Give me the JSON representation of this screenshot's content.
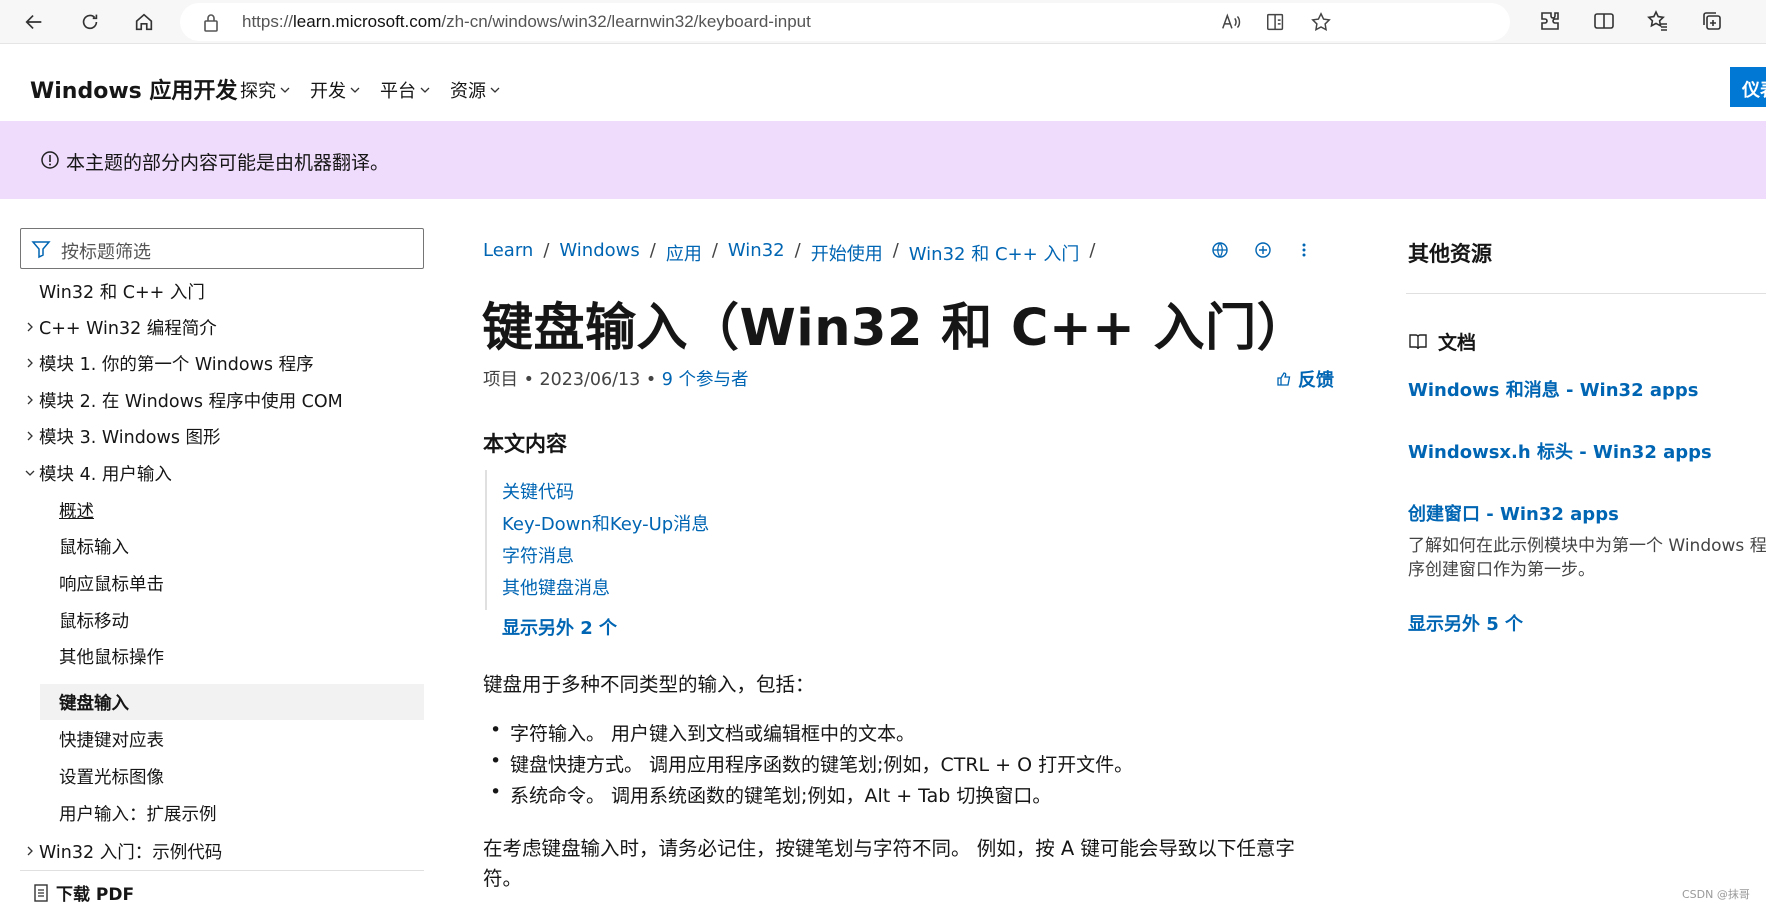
{
  "browser": {
    "url_prefix": "https://",
    "url_host": "learn.microsoft.com",
    "url_path": "/zh-cn/windows/win32/learnwin32/keyboard-input"
  },
  "header": {
    "site_title": "Windows 应用开发",
    "nav": [
      "探究",
      "开发",
      "平台",
      "资源"
    ],
    "cta": "仪表"
  },
  "banner": {
    "text": "本主题的部分内容可能是由机器翻译。"
  },
  "sidebar": {
    "filter_placeholder": "按标题筛选",
    "items": [
      {
        "label": "Win32 和 C++ 入门",
        "level": 0,
        "arrow": "none"
      },
      {
        "label": "C++ Win32 编程简介",
        "level": 0,
        "arrow": "right"
      },
      {
        "label": "模块 1. 你的第一个 Windows 程序",
        "level": 0,
        "arrow": "right"
      },
      {
        "label": "模块 2. 在 Windows 程序中使用 COM",
        "level": 0,
        "arrow": "right"
      },
      {
        "label": "模块 3. Windows 图形",
        "level": 0,
        "arrow": "right"
      },
      {
        "label": "模块 4. 用户输入",
        "level": 0,
        "arrow": "down"
      },
      {
        "label": "概述",
        "level": 1,
        "arrow": "none"
      },
      {
        "label": "鼠标输入",
        "level": 1,
        "arrow": "none"
      },
      {
        "label": "响应鼠标单击",
        "level": 1,
        "arrow": "none"
      },
      {
        "label": "鼠标移动",
        "level": 1,
        "arrow": "none"
      },
      {
        "label": "其他鼠标操作",
        "level": 1,
        "arrow": "none"
      },
      {
        "label": "键盘输入",
        "level": 1,
        "arrow": "none"
      },
      {
        "label": "快捷键对应表",
        "level": 1,
        "arrow": "none"
      },
      {
        "label": "设置光标图像",
        "level": 1,
        "arrow": "none"
      },
      {
        "label": "用户输入：扩展示例",
        "level": 1,
        "arrow": "none"
      },
      {
        "label": "Win32 入门：示例代码",
        "level": 0,
        "arrow": "right"
      }
    ],
    "download_pdf": "下载 PDF"
  },
  "breadcrumb": [
    "Learn",
    "Windows",
    "应用",
    "Win32",
    "开始使用",
    "Win32 和 C++ 入门"
  ],
  "article": {
    "title": "键盘输入（Win32 和 C++ 入门）",
    "meta_type": "项目",
    "meta_date": "2023/06/13",
    "meta_contributors": "9 个参与者",
    "feedback": "反馈",
    "in_article_heading": "本文内容",
    "toc_links": [
      "关键代码",
      "Key-Down和Key-Up消息",
      "字符消息",
      "其他键盘消息"
    ],
    "show_more": "显示另外 2 个",
    "intro": "键盘用于多种不同类型的输入，包括：",
    "bullets": [
      "字符输入。 用户键入到文档或编辑框中的文本。",
      "键盘快捷方式。 调用应用程序函数的键笔划;例如，CTRL + O 打开文件。",
      "系统命令。 调用系统函数的键笔划;例如，Alt + Tab 切换窗口。"
    ],
    "para2_line1": "在考虑键盘输入时，请务必记住，按键笔划与字符不同。 例如，按 A 键可能会导致以下任意字",
    "para2_line2": "符。"
  },
  "right_rail": {
    "title": "其他资源",
    "docs_heading": "文档",
    "links": [
      "Windows 和消息 - Win32 apps",
      "Windowsx.h 标头 - Win32 apps",
      "创建窗口 - Win32 apps"
    ],
    "desc": "了解如何在此示例模块中为第一个 Windows 程序创建窗口作为第一步。",
    "show_more": "显示另外 5 个"
  },
  "watermark": "CSDN @抹哥"
}
